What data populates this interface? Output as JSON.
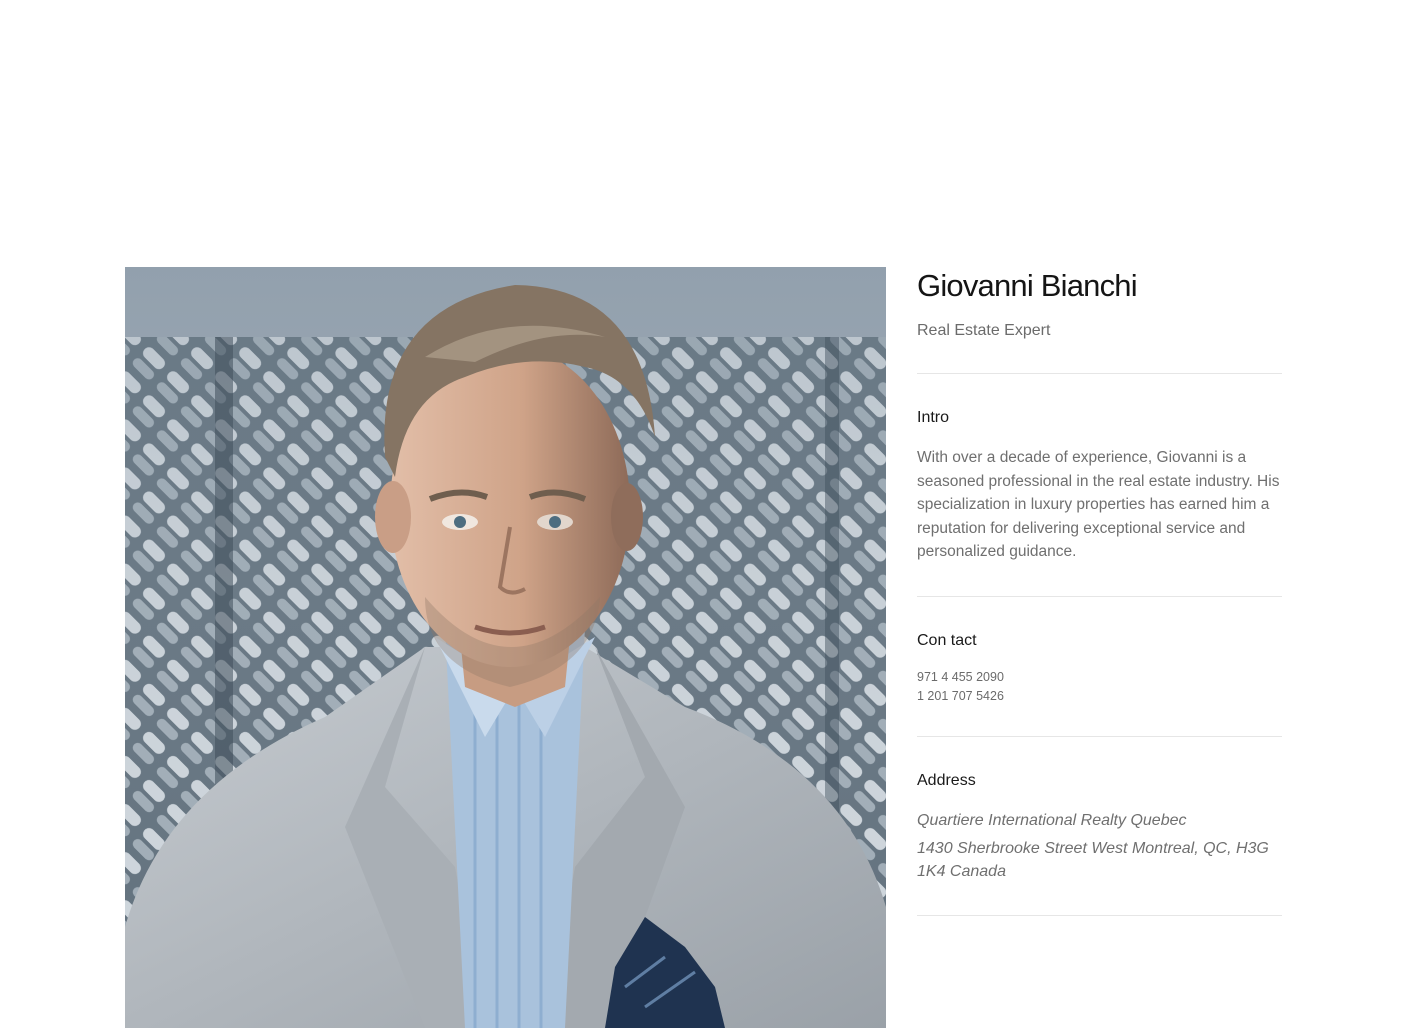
{
  "profile": {
    "name": "Giovanni Bianchi",
    "role": "Real Estate Expert"
  },
  "intro": {
    "title": "Intro",
    "text": "With over a decade of experience, Giovanni is a seasoned professional in the real estate industry. His specialization in luxury properties has earned him a reputation for delivering exceptional service and personalized guidance."
  },
  "contact": {
    "title": "Con tact",
    "phones": [
      "971 4 455 2090",
      "1 201 707 5426"
    ]
  },
  "address": {
    "title": "Address",
    "company": "Quartiere International Realty Quebec",
    "street": "1430 Sherbrooke Street West Montreal, QC, H3G 1K4 Canada"
  },
  "image": {
    "subject": "portrait-photo",
    "colors": {
      "background": "#7f8e9b",
      "jacket": "#b9bec4",
      "shirt": "#a9c2dc",
      "skin": "#d2a88f",
      "hair": "#8a7a68",
      "pocket_square": "#1f3350"
    }
  }
}
